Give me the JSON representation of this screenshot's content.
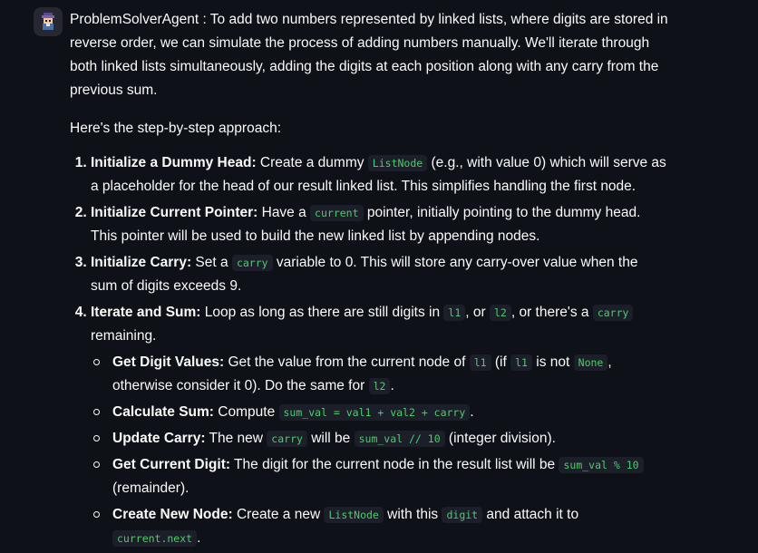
{
  "message": {
    "agent": "ProblemSolverAgent",
    "intro_rest": " : To add two numbers represented by linked lists, where digits are stored in reverse order, we can simulate the process of adding numbers manually. We'll iterate through both linked lists simultaneously, adding the digits at each position along with any carry from the previous sum.",
    "approach": "Here's the step-by-step approach:",
    "steps": [
      {
        "title": "Initialize a Dummy Head:",
        "t1": " Create a dummy ",
        "c1": "ListNode",
        "t2": " (e.g., with value 0) which will serve as a placeholder for the head of our result linked list. This simplifies handling the first node."
      },
      {
        "title": "Initialize Current Pointer:",
        "t1": " Have a ",
        "c1": "current",
        "t2": " pointer, initially pointing to the dummy head. This pointer will be used to build the new linked list by appending nodes."
      },
      {
        "title": "Initialize Carry:",
        "t1": " Set a ",
        "c1": "carry",
        "t2": " variable to 0. This will store any carry-over value when the sum of digits exceeds 9."
      },
      {
        "title": "Iterate and Sum:",
        "t1": " Loop as long as there are still digits in ",
        "c1": "l1",
        "t2": ", or ",
        "c2": "l2",
        "t3": ", or there's a ",
        "c3": "carry",
        "t4": " remaining.",
        "sub": [
          {
            "title": "Get Digit Values:",
            "t1": " Get the value from the current node of ",
            "c1": "l1",
            "t2": " (if ",
            "c2": "l1",
            "t3": " is not ",
            "c3": "None",
            "t4": ", otherwise consider it 0). Do the same for ",
            "c4": "l2",
            "t5": "."
          },
          {
            "title": "Calculate Sum:",
            "t1": " Compute ",
            "c1": "sum_val = val1 + val2 + carry",
            "t2": "."
          },
          {
            "title": "Update Carry:",
            "t1": " The new ",
            "c1": "carry",
            "t2": " will be ",
            "c2": "sum_val // 10",
            "t3": " (integer division)."
          },
          {
            "title": "Get Current Digit:",
            "t1": " The digit for the current node in the result list will be ",
            "c1": "sum_val % 10",
            "t2": " (remainder)."
          },
          {
            "title": "Create New Node:",
            "t1": " Create a new ",
            "c1": "ListNode",
            "t2": " with this ",
            "c2": "digit",
            "t3": " and attach it to ",
            "c3": "current.next",
            "t4": "."
          }
        ]
      }
    ]
  },
  "avatar_icon": "agent-avatar-icon"
}
